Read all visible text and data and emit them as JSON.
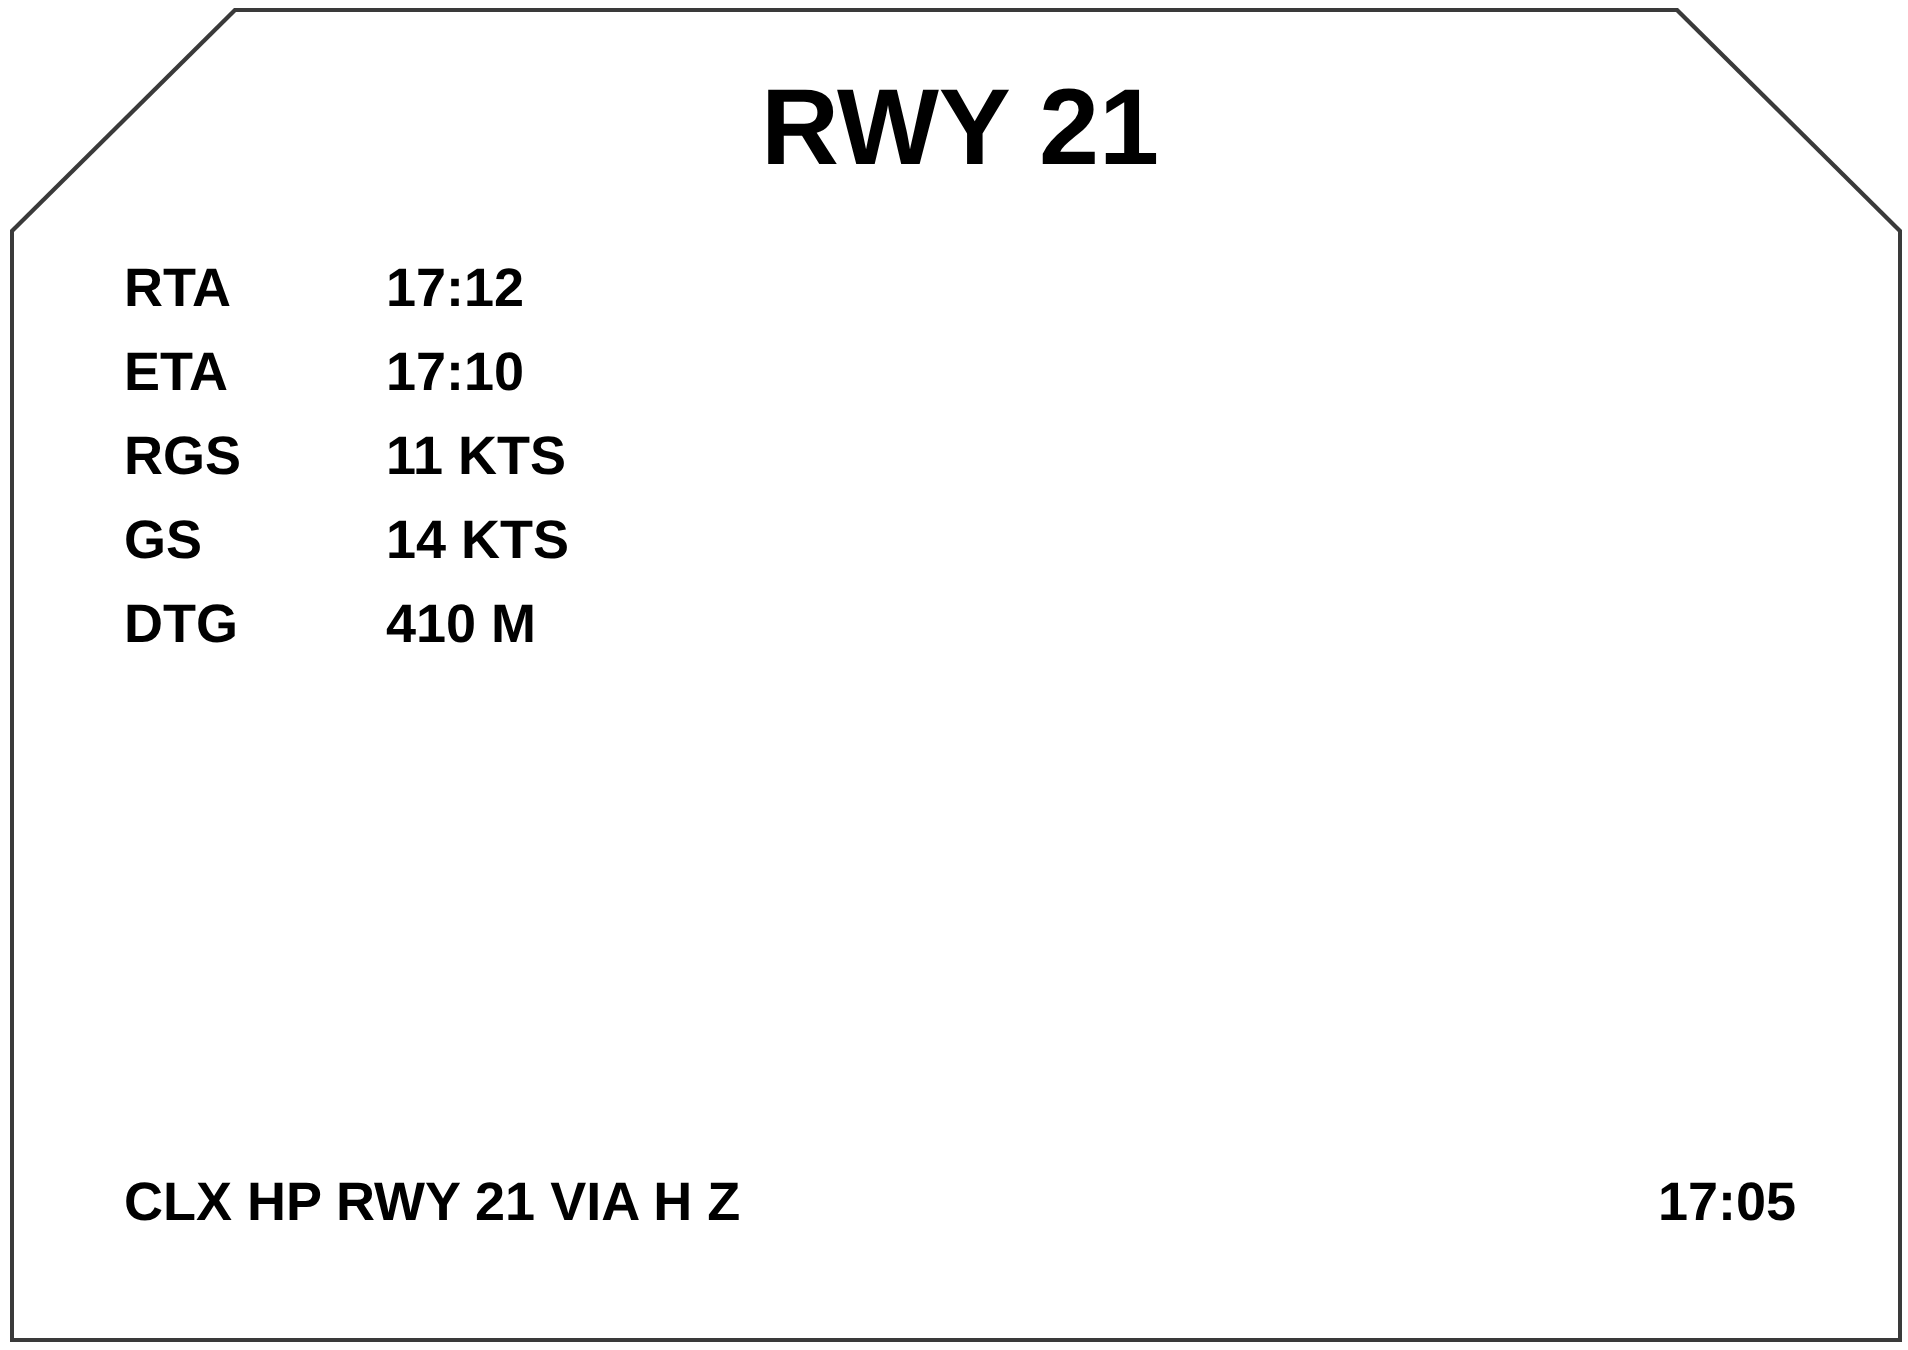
{
  "title": "RWY 21",
  "fields": [
    {
      "label": "RTA",
      "value": "17:12"
    },
    {
      "label": "ETA",
      "value": "17:10"
    },
    {
      "label": "RGS",
      "value": "11 KTS"
    },
    {
      "label": "GS",
      "value": "14 KTS"
    },
    {
      "label": "DTG",
      "value": "410 M"
    }
  ],
  "footer": {
    "message": "CLX HP RWY 21 VIA H Z",
    "time": "17:05"
  }
}
